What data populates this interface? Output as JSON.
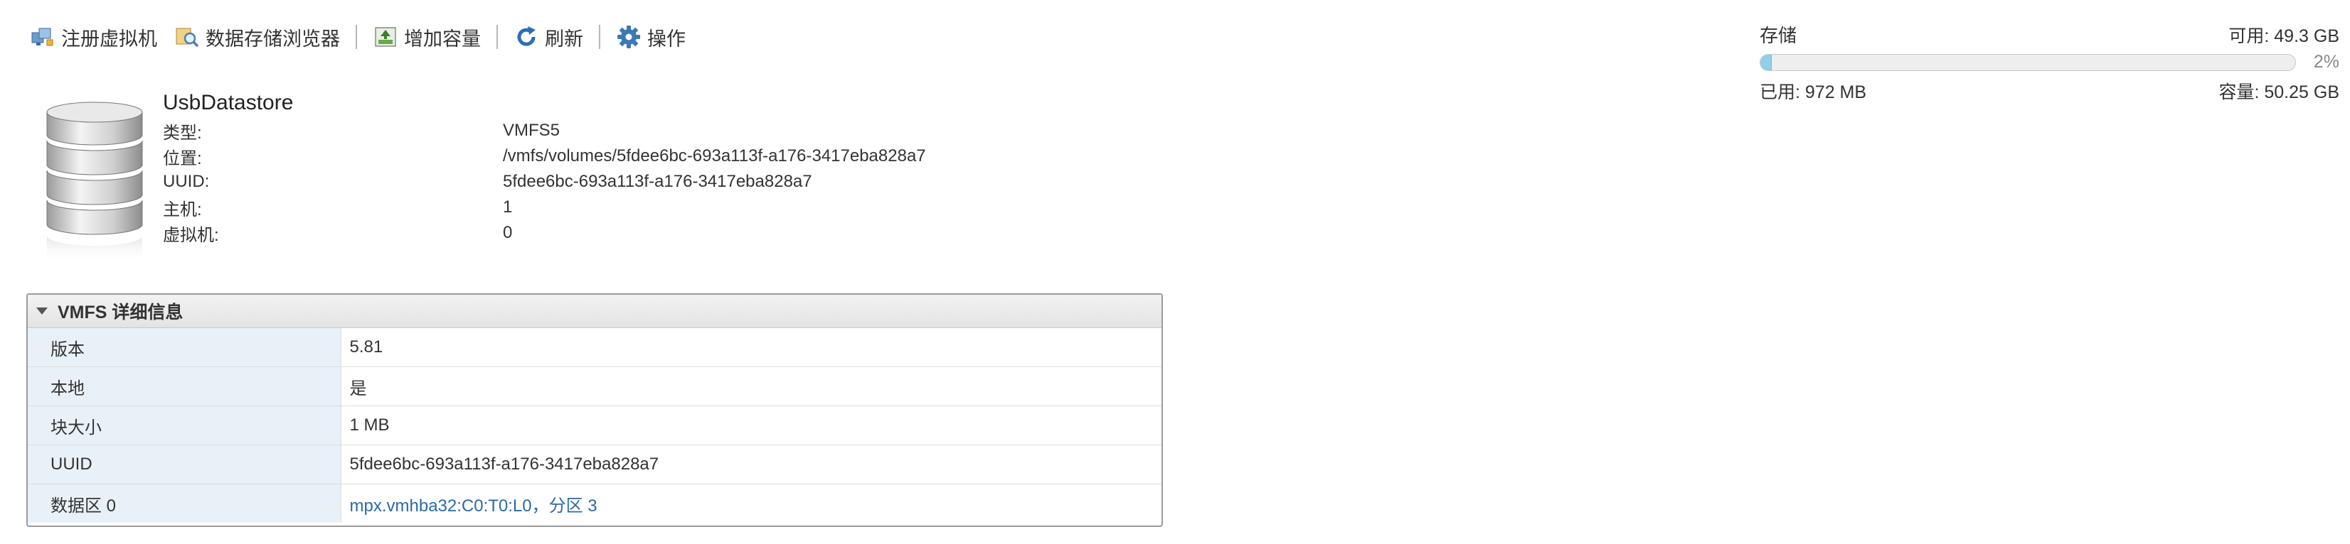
{
  "toolbar": {
    "register_vm": "注册虚拟机",
    "datastore_browser": "数据存储浏览器",
    "increase_capacity": "增加容量",
    "refresh": "刷新",
    "actions": "操作"
  },
  "storage": {
    "title": "存储",
    "free": "可用: 49.3 GB",
    "percent_label": "2%",
    "used_fraction": 0.02,
    "used": "已用: 972 MB",
    "capacity": "容量: 50.25 GB"
  },
  "datastore": {
    "name": "UsbDatastore",
    "rows": [
      {
        "label": "类型:",
        "value": "VMFS5"
      },
      {
        "label": "位置:",
        "value": "/vmfs/volumes/5fdee6bc-693a113f-a176-3417eba828a7"
      },
      {
        "label": "UUID:",
        "value": "5fdee6bc-693a113f-a176-3417eba828a7"
      },
      {
        "label": "主机:",
        "value": "1"
      },
      {
        "label": "虚拟机:",
        "value": "0"
      }
    ]
  },
  "vmfs_panel": {
    "title": "VMFS 详细信息",
    "rows": [
      {
        "key": "版本",
        "value": "5.81"
      },
      {
        "key": "本地",
        "value": "是"
      },
      {
        "key": "块大小",
        "value": "1 MB"
      },
      {
        "key": "UUID",
        "value": "5fdee6bc-693a113f-a176-3417eba828a7"
      },
      {
        "key": "数据区 0",
        "value": "mpx.vmhba32:C0:T0:L0，分区 3"
      }
    ]
  },
  "colors": {
    "accent": "#2b6aa5",
    "bar_fill": "#8ed0ea",
    "key_cell_bg": "#e9f1f8"
  }
}
